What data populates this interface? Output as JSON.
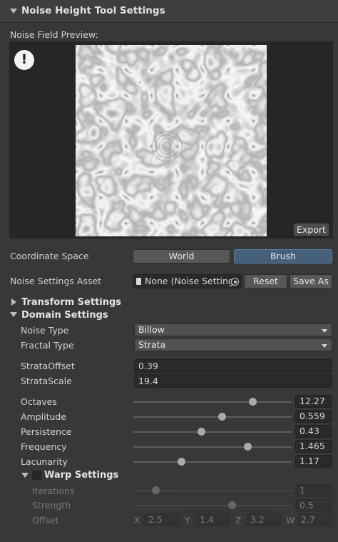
{
  "header": {
    "title": "Noise Height Tool Settings"
  },
  "preview": {
    "label": "Noise Field Preview:",
    "export_label": "Export"
  },
  "coordinate_space": {
    "label": "Coordinate Space",
    "options": [
      "World",
      "Brush"
    ],
    "selected": "Brush"
  },
  "noise_asset": {
    "label": "Noise Settings Asset",
    "value": "None (Noise Setting",
    "reset_label": "Reset",
    "save_as_label": "Save As"
  },
  "transform": {
    "label": "Transform Settings",
    "expanded": false
  },
  "domain": {
    "label": "Domain Settings",
    "expanded": true,
    "noise_type": {
      "label": "Noise Type",
      "value": "Billow"
    },
    "fractal_type": {
      "label": "Fractal Type",
      "value": "Strata"
    },
    "strata_offset": {
      "label": "StrataOffset",
      "value": "0.39"
    },
    "strata_scale": {
      "label": "StrataScale",
      "value": "19.4"
    },
    "sliders": [
      {
        "label": "Octaves",
        "value": "12.27",
        "fraction": 0.75
      },
      {
        "label": "Amplitude",
        "value": "0.559",
        "fraction": 0.56
      },
      {
        "label": "Persistence",
        "value": "0.43",
        "fraction": 0.43
      },
      {
        "label": "Frequency",
        "value": "1.465",
        "fraction": 0.72
      },
      {
        "label": "Lacunarity",
        "value": "1.17",
        "fraction": 0.3
      }
    ]
  },
  "warp": {
    "label": "Warp Settings",
    "enabled": false,
    "iterations": {
      "label": "Iterations",
      "value": "1",
      "fraction": 0.14
    },
    "strength": {
      "label": "Strength",
      "value": "0.5",
      "fraction": 0.62
    },
    "offset": {
      "label": "Offset",
      "x_label": "X",
      "x": "2.5",
      "y_label": "Y",
      "y": "1.4",
      "z_label": "Z",
      "z": "3.2",
      "w_label": "W",
      "w": "2.7"
    }
  },
  "colors": {
    "background": "#383838",
    "active_button": "#46607c",
    "field": "#2a2a2a"
  }
}
